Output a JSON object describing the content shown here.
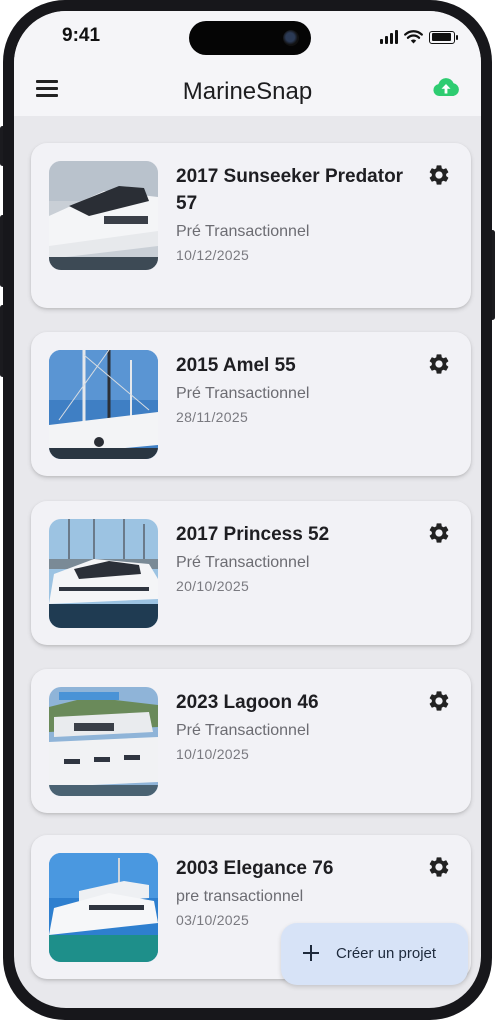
{
  "status_bar": {
    "time": "9:41"
  },
  "app_bar": {
    "title": "MarineSnap",
    "menu_icon": "menu-icon",
    "upload_icon": "cloud-upload-icon",
    "upload_color": "#2ecc71"
  },
  "projects": [
    {
      "title": "2017 Sunseeker Predator 57",
      "status": "Pré Transactionnel",
      "date": "10/12/2025"
    },
    {
      "title": "2015 Amel 55",
      "status": "Pré Transactionnel",
      "date": "28/11/2025"
    },
    {
      "title": "2017 Princess 52",
      "status": "Pré Transactionnel",
      "date": "20/10/2025"
    },
    {
      "title": "2023 Lagoon 46",
      "status": "Pré Transactionnel",
      "date": "10/10/2025"
    },
    {
      "title": "2003 Elegance 76",
      "status": "pre transactionnel",
      "date": "03/10/2025"
    }
  ],
  "fab": {
    "label": "Créer un projet",
    "icon": "plus-icon"
  },
  "colors": {
    "accent": "#2ecc71",
    "fab_background": "#d7e3f7",
    "card_background": "#f2f2f6"
  }
}
